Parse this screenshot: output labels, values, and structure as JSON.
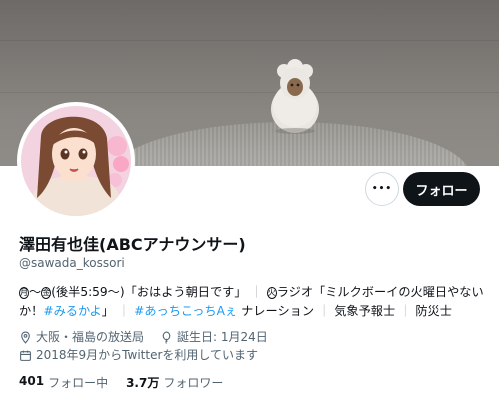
{
  "profile": {
    "display_name": "澤田有也佳(ABCアナウンサー)",
    "handle": "@sawada_kossori"
  },
  "actions": {
    "more_label": "•••",
    "follow_label": "フォロー"
  },
  "bio": {
    "mon": "月",
    "sat": "金",
    "tue": "火",
    "part1": "〜",
    "part2": "(後半5:59〜)「おはよう朝日です」",
    "part3": "ラジオ「ミルクボーイの火曜日やない",
    "part4": "か！",
    "tag1": "#みるかよ",
    "part5": "」",
    "tag2": "#あっちこっちAぇ",
    "part6": "ナレーション",
    "part7": "気象予報士",
    "part8": "防災士",
    "sep": "｜"
  },
  "meta": {
    "location": "大阪・福島の放送局",
    "birthday": "誕生日: 1月24日",
    "joined": "2018年9月からTwitterを利用しています"
  },
  "stats": {
    "following_count": "401",
    "following_label": "フォロー中",
    "followers_count": "3.7万",
    "followers_label": "フォロワー"
  }
}
